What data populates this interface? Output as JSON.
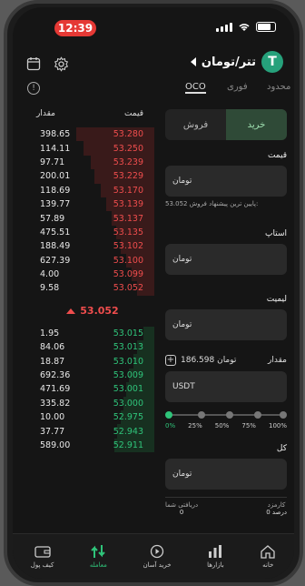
{
  "status": {
    "time": "12:39"
  },
  "header": {
    "pair": "تتر/تومان",
    "coin_letter": "T"
  },
  "tabs": {
    "active": "OCO",
    "t2": "فوری",
    "t3": "محدود"
  },
  "book": {
    "amount_header": "مقدار",
    "price_header": "قیمت",
    "asks": [
      {
        "amount": "398.65",
        "price": "53.280",
        "depth": 0.55
      },
      {
        "amount": "114.11",
        "price": "53.250",
        "depth": 0.5
      },
      {
        "amount": "97.71",
        "price": "53.239",
        "depth": 0.45
      },
      {
        "amount": "200.01",
        "price": "53.229",
        "depth": 0.42
      },
      {
        "amount": "118.69",
        "price": "53.170",
        "depth": 0.38
      },
      {
        "amount": "139.77",
        "price": "53.139",
        "depth": 0.34
      },
      {
        "amount": "57.89",
        "price": "53.137",
        "depth": 0.3
      },
      {
        "amount": "475.51",
        "price": "53.135",
        "depth": 0.27
      },
      {
        "amount": "188.49",
        "price": "53.102",
        "depth": 0.24
      },
      {
        "amount": "627.39",
        "price": "53.100",
        "depth": 0.2
      },
      {
        "amount": "4.00",
        "price": "53.099",
        "depth": 0.16
      },
      {
        "amount": "9.58",
        "price": "53.052",
        "depth": 0.12
      }
    ],
    "last_price": "53.052",
    "bids": [
      {
        "amount": "1.95",
        "price": "53.015",
        "depth": 0.08
      },
      {
        "amount": "84.06",
        "price": "53.013",
        "depth": 0.12
      },
      {
        "amount": "18.87",
        "price": "53.010",
        "depth": 0.15
      },
      {
        "amount": "692.36",
        "price": "53.009",
        "depth": 0.18
      },
      {
        "amount": "471.69",
        "price": "53.001",
        "depth": 0.2
      },
      {
        "amount": "335.82",
        "price": "53.000",
        "depth": 0.22
      },
      {
        "amount": "10.00",
        "price": "52.975",
        "depth": 0.24
      },
      {
        "amount": "37.77",
        "price": "52.943",
        "depth": 0.26
      },
      {
        "amount": "589.00",
        "price": "52.911",
        "depth": 0.28
      }
    ]
  },
  "form": {
    "buy": "خرید",
    "sell": "فروش",
    "price_label": "قیمت",
    "price_unit": "تومان",
    "price_hint_label": "پایین ترین پیشنهاد فروش:",
    "price_hint_value": "53.052",
    "stop_label": "استاپ",
    "stop_unit": "تومان",
    "limit_label": "لیمیت",
    "limit_unit": "تومان",
    "amount_label": "مقدار",
    "balance": "186.598 تومان",
    "amount_unit": "USDT",
    "ticks": [
      "0%",
      "25%",
      "50%",
      "75%",
      "100%"
    ],
    "slider_value": 0,
    "total_label": "کل",
    "total_unit": "تومان",
    "fee_label": "کارمزد",
    "fee_value": "0 درصد",
    "receive_label": "دریافتی شما",
    "receive_value": "0"
  },
  "nav": {
    "wallet": "کیف پول",
    "trade": "معامله",
    "easy_buy": "خرید آسان",
    "markets": "بازارها",
    "home": "خانه"
  },
  "colors": {
    "ask": "#ef4d4d",
    "bid": "#2fc47a",
    "buy_bg": "#2f4a37"
  }
}
